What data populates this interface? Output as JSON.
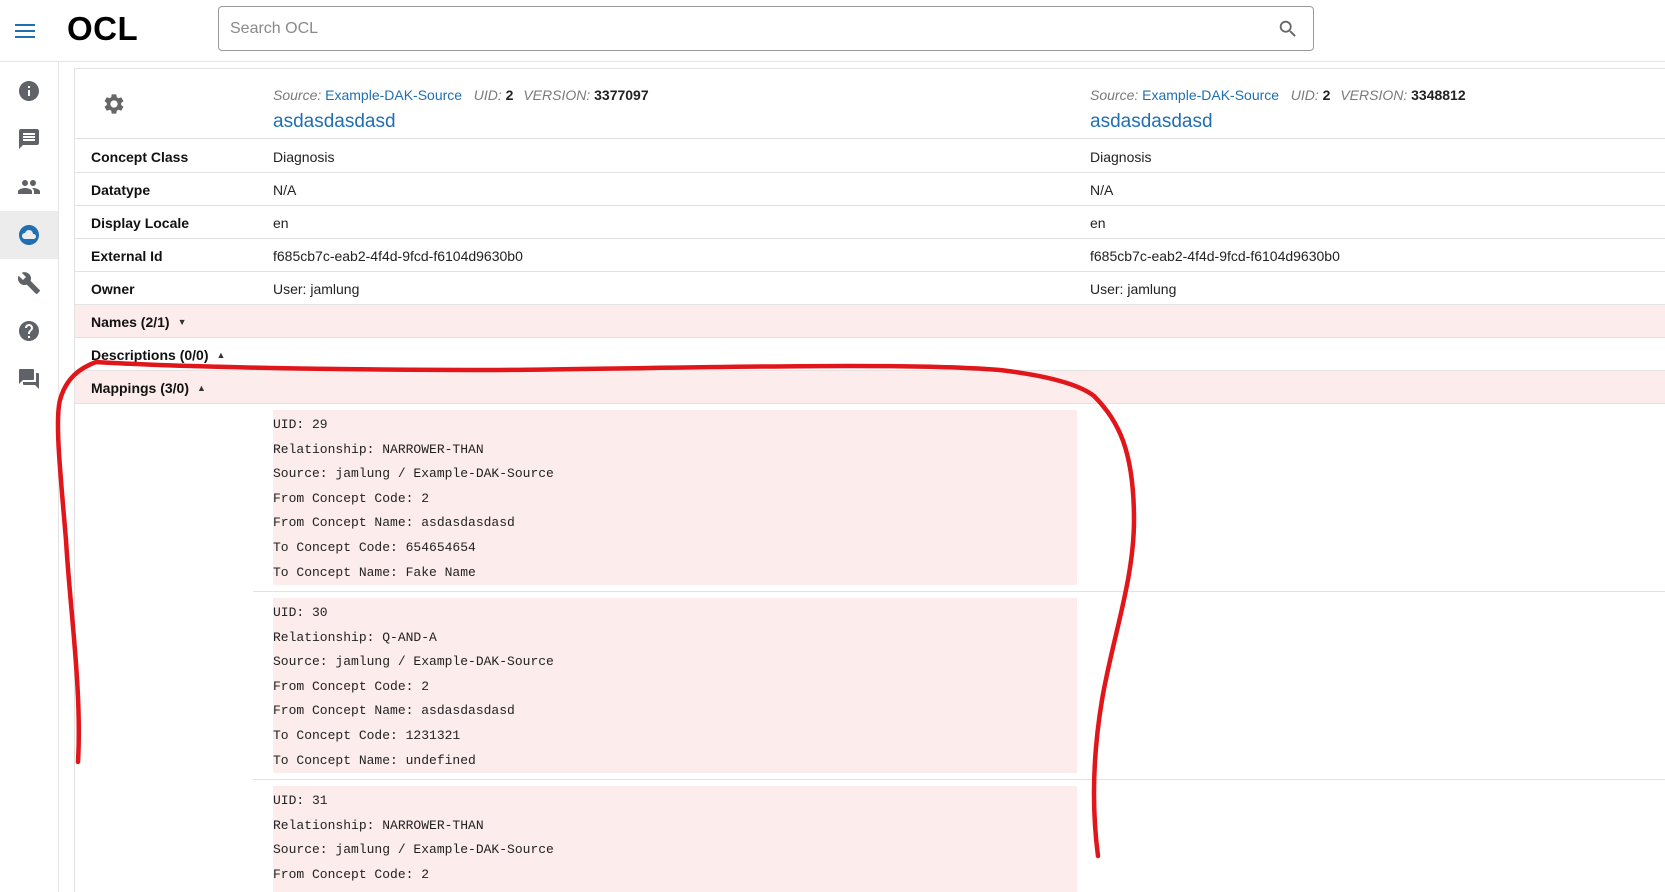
{
  "header": {
    "logo": "OCL",
    "search_placeholder": "Search OCL"
  },
  "sidebar": {
    "items": [
      {
        "name": "info",
        "icon": "info-icon"
      },
      {
        "name": "comment",
        "icon": "comment-icon"
      },
      {
        "name": "people",
        "icon": "people-icon"
      },
      {
        "name": "cloud",
        "icon": "cloud-icon",
        "active": true
      },
      {
        "name": "build",
        "icon": "wrench-icon"
      },
      {
        "name": "help",
        "icon": "help-icon"
      },
      {
        "name": "forum",
        "icon": "forum-icon"
      }
    ]
  },
  "versions": [
    {
      "source_label": "Source:",
      "source": "Example-DAK-Source",
      "uid_label": "UID:",
      "uid": "2",
      "version_label": "VERSION:",
      "version": "3377097",
      "title": "asdasdasdasd"
    },
    {
      "source_label": "Source:",
      "source": "Example-DAK-Source",
      "uid_label": "UID:",
      "uid": "2",
      "version_label": "VERSION:",
      "version": "3348812",
      "title": "asdasdasdasd"
    }
  ],
  "attributes": [
    {
      "label": "Concept Class",
      "left": "Diagnosis",
      "right": "Diagnosis"
    },
    {
      "label": "Datatype",
      "left": "N/A",
      "right": "N/A"
    },
    {
      "label": "Display Locale",
      "left": "en",
      "right": "en"
    },
    {
      "label": "External Id",
      "left": "f685cb7c-eab2-4f4d-9fcd-f6104d9630b0",
      "right": "f685cb7c-eab2-4f4d-9fcd-f6104d9630b0"
    },
    {
      "label": "Owner",
      "left": "User: jamlung",
      "right": "User: jamlung"
    }
  ],
  "sections": {
    "names": {
      "label": "Names (2/1)",
      "caret": "▼"
    },
    "descriptions": {
      "label": "Descriptions (0/0)",
      "caret": "▲"
    },
    "mappings": {
      "label": "Mappings (3/0)",
      "caret": "▲"
    }
  },
  "mappings": [
    {
      "lines": [
        "UID: 29",
        "Relationship: NARROWER-THAN",
        "Source: jamlung / Example-DAK-Source",
        "From Concept Code: 2",
        "From Concept Name: asdasdasdasd",
        "To Concept Code: 654654654",
        "To Concept Name: Fake Name"
      ]
    },
    {
      "lines": [
        "UID: 30",
        "Relationship: Q-AND-A",
        "Source: jamlung / Example-DAK-Source",
        "From Concept Code: 2",
        "From Concept Name: asdasdasdasd",
        "To Concept Code: 1231321",
        "To Concept Name: undefined"
      ]
    },
    {
      "lines": [
        "UID: 31",
        "Relationship: NARROWER-THAN",
        "Source: jamlung / Example-DAK-Source",
        "From Concept Code: 2"
      ]
    }
  ],
  "colors": {
    "accent": "#1f6fb2",
    "highlight": "#fdecec",
    "annotation": "#e0161b"
  }
}
